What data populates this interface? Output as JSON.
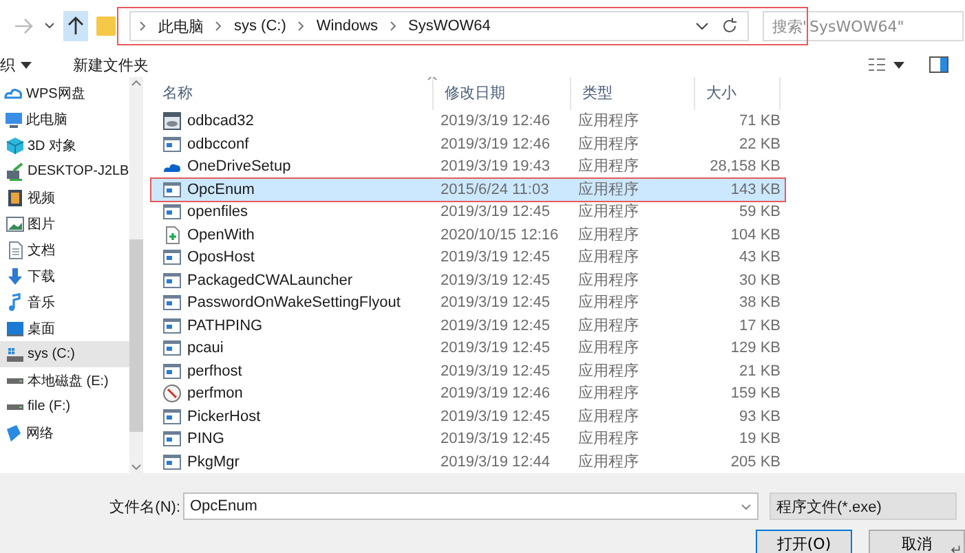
{
  "address_bar": {
    "segments": [
      "此电脑",
      "sys (C:)",
      "Windows",
      "SysWOW64"
    ]
  },
  "search": {
    "placeholder": "搜索\"SysWOW64\""
  },
  "toolbar": {
    "organize": "织",
    "new_folder": "新建文件夹"
  },
  "sidebar": {
    "items": [
      {
        "label": "WPS网盘",
        "kind": "cloud",
        "selected": false
      },
      {
        "label": "此电脑",
        "kind": "pc",
        "selected": false,
        "children": [
          {
            "label": "3D 对象",
            "kind": "cube",
            "selected": false
          },
          {
            "label": "DESKTOP-J2LB",
            "kind": "netpc",
            "selected": false
          },
          {
            "label": "视频",
            "kind": "video",
            "selected": false
          },
          {
            "label": "图片",
            "kind": "image",
            "selected": false
          },
          {
            "label": "文档",
            "kind": "doc",
            "selected": false
          },
          {
            "label": "下载",
            "kind": "download",
            "selected": false
          },
          {
            "label": "音乐",
            "kind": "music",
            "selected": false
          },
          {
            "label": "桌面",
            "kind": "desktop",
            "selected": false
          },
          {
            "label": "sys (C:)",
            "kind": "sysdrive",
            "selected": true
          },
          {
            "label": "本地磁盘 (E:)",
            "kind": "drive",
            "selected": false
          },
          {
            "label": "file (F:)",
            "kind": "drive",
            "selected": false
          }
        ]
      },
      {
        "label": "网络",
        "kind": "network",
        "selected": false
      }
    ]
  },
  "table": {
    "columns": [
      "名称",
      "修改日期",
      "类型",
      "大小"
    ],
    "rows": [
      {
        "name": "odbcad32",
        "kind": "odbc",
        "date": "2019/3/19 12:46",
        "type": "应用程序",
        "size": "71 KB",
        "selected": false
      },
      {
        "name": "odbcconf",
        "kind": "app",
        "date": "2019/3/19 12:46",
        "type": "应用程序",
        "size": "22 KB",
        "selected": false
      },
      {
        "name": "OneDriveSetup",
        "kind": "onedrive",
        "date": "2019/3/19 19:43",
        "type": "应用程序",
        "size": "28,158 KB",
        "selected": false
      },
      {
        "name": "OpcEnum",
        "kind": "app",
        "date": "2015/6/24 11:03",
        "type": "应用程序",
        "size": "143 KB",
        "selected": true
      },
      {
        "name": "openfiles",
        "kind": "app",
        "date": "2019/3/19 12:45",
        "type": "应用程序",
        "size": "59 KB",
        "selected": false
      },
      {
        "name": "OpenWith",
        "kind": "openwith",
        "date": "2020/10/15 12:16",
        "type": "应用程序",
        "size": "104 KB",
        "selected": false
      },
      {
        "name": "OposHost",
        "kind": "app",
        "date": "2019/3/19 12:45",
        "type": "应用程序",
        "size": "43 KB",
        "selected": false
      },
      {
        "name": "PackagedCWALauncher",
        "kind": "app",
        "date": "2019/3/19 12:45",
        "type": "应用程序",
        "size": "30 KB",
        "selected": false
      },
      {
        "name": "PasswordOnWakeSettingFlyout",
        "kind": "app",
        "date": "2019/3/19 12:45",
        "type": "应用程序",
        "size": "38 KB",
        "selected": false
      },
      {
        "name": "PATHPING",
        "kind": "app",
        "date": "2019/3/19 12:45",
        "type": "应用程序",
        "size": "17 KB",
        "selected": false
      },
      {
        "name": "pcaui",
        "kind": "app",
        "date": "2019/3/19 12:45",
        "type": "应用程序",
        "size": "129 KB",
        "selected": false
      },
      {
        "name": "perfhost",
        "kind": "app",
        "date": "2019/3/19 12:45",
        "type": "应用程序",
        "size": "21 KB",
        "selected": false
      },
      {
        "name": "perfmon",
        "kind": "perfmon",
        "date": "2019/3/19 12:46",
        "type": "应用程序",
        "size": "159 KB",
        "selected": false
      },
      {
        "name": "PickerHost",
        "kind": "app",
        "date": "2019/3/19 12:45",
        "type": "应用程序",
        "size": "93 KB",
        "selected": false
      },
      {
        "name": "PING",
        "kind": "app",
        "date": "2019/3/19 12:45",
        "type": "应用程序",
        "size": "19 KB",
        "selected": false
      },
      {
        "name": "PkgMgr",
        "kind": "app",
        "date": "2019/3/19 12:44",
        "type": "应用程序",
        "size": "205 KB",
        "selected": false
      }
    ]
  },
  "footer": {
    "filename_label": "文件名(N):",
    "filename_value": "OpcEnum",
    "filter": "程序文件(*.exe)",
    "open_button": "打开(O)",
    "cancel_button": "取消"
  },
  "return_mark": "↵"
}
